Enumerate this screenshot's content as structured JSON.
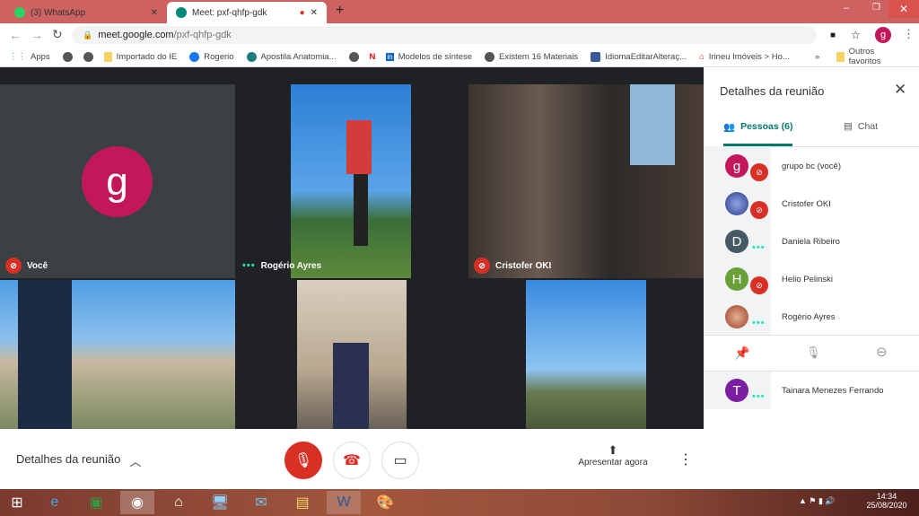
{
  "browser": {
    "tabs": [
      {
        "title": "(3) WhatsApp",
        "active": false
      },
      {
        "title": "Meet: pxf-qhfp-gdk",
        "active": true
      }
    ],
    "url_host": "meet.google.com",
    "url_path": "/pxf-qhfp-gdk",
    "profile_initial": "g",
    "bookmarks": [
      "Apps",
      "Importado do IE",
      "Rogerio",
      "Apostila Anatomia...",
      "Modelos de síntese",
      "Existem 16 Materiais",
      "IdiomaEditarAlteraç...",
      "Irineu Imóveis > Ho..."
    ],
    "bookmarks_more": "»",
    "other_bookmarks": "Outros favoritos"
  },
  "meet": {
    "tiles": [
      {
        "name": "Você",
        "muted": true,
        "avatar": "g"
      },
      {
        "name": "Rogério Ayres",
        "muted": false
      },
      {
        "name": "Cristofer OKI",
        "muted": true
      }
    ],
    "bottom": {
      "details_label": "Detalhes da reunião",
      "present_label": "Apresentar agora"
    },
    "accent": "#00796b",
    "mute_color": "#d93025"
  },
  "panel": {
    "title": "Detalhes da reunião",
    "tab_people": "Pessoas (6)",
    "tab_chat": "Chat",
    "people": [
      {
        "initial": "g",
        "name": "grupo bc (você)",
        "color": "#c2185b",
        "muted": true
      },
      {
        "initial": "",
        "name": "Cristofer OKI",
        "color": "#3f51b5",
        "muted": true
      },
      {
        "initial": "D",
        "name": "Daniela Ribeiro",
        "color": "#455a64",
        "muted": false
      },
      {
        "initial": "H",
        "name": "Helio Pelinski",
        "color": "#689f38",
        "muted": true
      },
      {
        "initial": "",
        "name": "Rogério Ayres",
        "color": "#bf5a3a",
        "muted": false
      },
      {
        "initial": "T",
        "name": "Tainara Menezes Ferrando",
        "color": "#7b1fa2",
        "muted": false
      }
    ]
  },
  "taskbar": {
    "time": "14:34",
    "date": "25/08/2020"
  }
}
